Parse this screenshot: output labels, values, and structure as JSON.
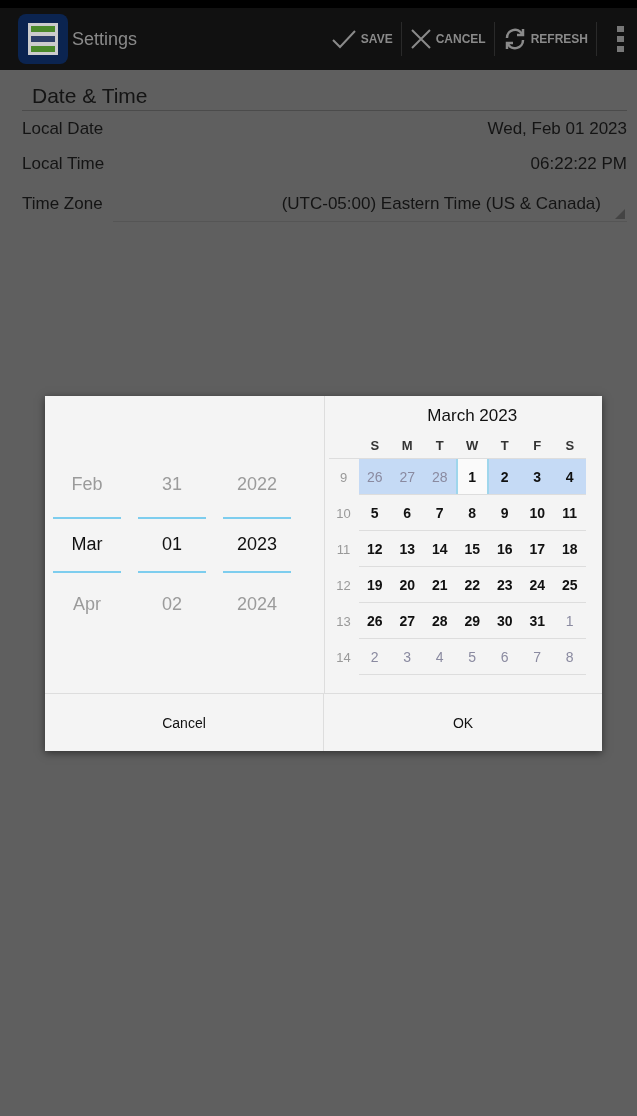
{
  "toolbar": {
    "title": "Settings",
    "actions": [
      {
        "kind": "save",
        "label": "SAVE"
      },
      {
        "kind": "cancel",
        "label": "CANCEL"
      },
      {
        "kind": "refresh",
        "label": "REFRESH"
      }
    ]
  },
  "section": {
    "title": "Date & Time",
    "rows": [
      {
        "label": "Local Date",
        "value": "Wed, Feb 01 2023",
        "kind": "text"
      },
      {
        "label": "Local Time",
        "value": "06:22:22 PM",
        "kind": "text"
      },
      {
        "label": "Time Zone",
        "value": "(UTC-05:00) Eastern Time (US & Canada)",
        "kind": "dropdown"
      }
    ]
  },
  "dialog": {
    "spinners": [
      {
        "items": [
          {
            "label": "Feb",
            "selected": false
          },
          {
            "label": "Mar",
            "selected": true
          },
          {
            "label": "Apr",
            "selected": false
          }
        ]
      },
      {
        "items": [
          {
            "label": "31",
            "selected": false
          },
          {
            "label": "01",
            "selected": true
          },
          {
            "label": "02",
            "selected": false
          }
        ]
      },
      {
        "items": [
          {
            "label": "2022",
            "selected": false
          },
          {
            "label": "2023",
            "selected": true
          },
          {
            "label": "2024",
            "selected": false
          }
        ]
      }
    ],
    "calendar": {
      "title": "March 2023",
      "weekdays": [
        "S",
        "M",
        "T",
        "W",
        "T",
        "F",
        "S"
      ],
      "weeks": [
        {
          "number": "9",
          "days": [
            {
              "label": "26",
              "outside": true,
              "highlighted": true,
              "selected": false
            },
            {
              "label": "27",
              "outside": true,
              "highlighted": true,
              "selected": false
            },
            {
              "label": "28",
              "outside": true,
              "highlighted": true,
              "selected": false
            },
            {
              "label": "1",
              "outside": false,
              "highlighted": false,
              "selected": true
            },
            {
              "label": "2",
              "outside": false,
              "highlighted": true,
              "selected": false
            },
            {
              "label": "3",
              "outside": false,
              "highlighted": true,
              "selected": false
            },
            {
              "label": "4",
              "outside": false,
              "highlighted": true,
              "selected": false
            }
          ]
        },
        {
          "number": "10",
          "days": [
            {
              "label": "5",
              "outside": false,
              "highlighted": false,
              "selected": false
            },
            {
              "label": "6",
              "outside": false,
              "highlighted": false,
              "selected": false
            },
            {
              "label": "7",
              "outside": false,
              "highlighted": false,
              "selected": false
            },
            {
              "label": "8",
              "outside": false,
              "highlighted": false,
              "selected": false
            },
            {
              "label": "9",
              "outside": false,
              "highlighted": false,
              "selected": false
            },
            {
              "label": "10",
              "outside": false,
              "highlighted": false,
              "selected": false
            },
            {
              "label": "11",
              "outside": false,
              "highlighted": false,
              "selected": false
            }
          ]
        },
        {
          "number": "11",
          "days": [
            {
              "label": "12",
              "outside": false,
              "highlighted": false,
              "selected": false
            },
            {
              "label": "13",
              "outside": false,
              "highlighted": false,
              "selected": false
            },
            {
              "label": "14",
              "outside": false,
              "highlighted": false,
              "selected": false
            },
            {
              "label": "15",
              "outside": false,
              "highlighted": false,
              "selected": false
            },
            {
              "label": "16",
              "outside": false,
              "highlighted": false,
              "selected": false
            },
            {
              "label": "17",
              "outside": false,
              "highlighted": false,
              "selected": false
            },
            {
              "label": "18",
              "outside": false,
              "highlighted": false,
              "selected": false
            }
          ]
        },
        {
          "number": "12",
          "days": [
            {
              "label": "19",
              "outside": false,
              "highlighted": false,
              "selected": false
            },
            {
              "label": "20",
              "outside": false,
              "highlighted": false,
              "selected": false
            },
            {
              "label": "21",
              "outside": false,
              "highlighted": false,
              "selected": false
            },
            {
              "label": "22",
              "outside": false,
              "highlighted": false,
              "selected": false
            },
            {
              "label": "23",
              "outside": false,
              "highlighted": false,
              "selected": false
            },
            {
              "label": "24",
              "outside": false,
              "highlighted": false,
              "selected": false
            },
            {
              "label": "25",
              "outside": false,
              "highlighted": false,
              "selected": false
            }
          ]
        },
        {
          "number": "13",
          "days": [
            {
              "label": "26",
              "outside": false,
              "highlighted": false,
              "selected": false
            },
            {
              "label": "27",
              "outside": false,
              "highlighted": false,
              "selected": false
            },
            {
              "label": "28",
              "outside": false,
              "highlighted": false,
              "selected": false
            },
            {
              "label": "29",
              "outside": false,
              "highlighted": false,
              "selected": false
            },
            {
              "label": "30",
              "outside": false,
              "highlighted": false,
              "selected": false
            },
            {
              "label": "31",
              "outside": false,
              "highlighted": false,
              "selected": false
            },
            {
              "label": "1",
              "outside": true,
              "highlighted": false,
              "selected": false
            }
          ]
        },
        {
          "number": "14",
          "days": [
            {
              "label": "2",
              "outside": true,
              "highlighted": false,
              "selected": false
            },
            {
              "label": "3",
              "outside": true,
              "highlighted": false,
              "selected": false
            },
            {
              "label": "4",
              "outside": true,
              "highlighted": false,
              "selected": false
            },
            {
              "label": "5",
              "outside": true,
              "highlighted": false,
              "selected": false
            },
            {
              "label": "6",
              "outside": true,
              "highlighted": false,
              "selected": false
            },
            {
              "label": "7",
              "outside": true,
              "highlighted": false,
              "selected": false
            },
            {
              "label": "8",
              "outside": true,
              "highlighted": false,
              "selected": false
            }
          ]
        }
      ]
    },
    "buttons": [
      "Cancel",
      "OK"
    ]
  }
}
